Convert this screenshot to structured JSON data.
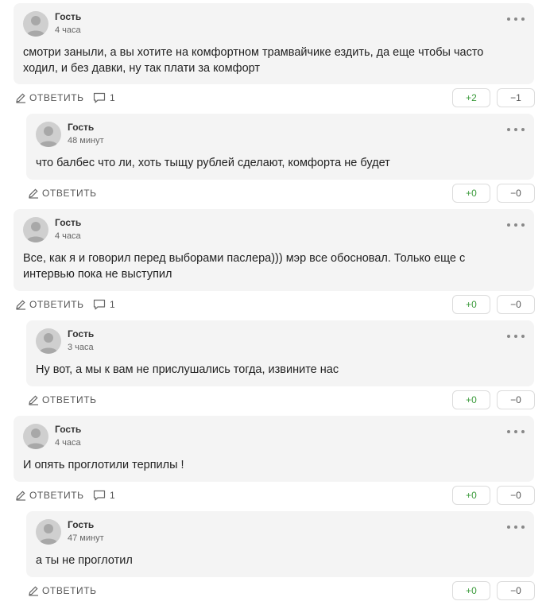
{
  "labels": {
    "reply": "ОТВЕТИТЬ"
  },
  "colors": {
    "bubble": "#f4f4f4",
    "plus": "#3a9a3a",
    "minus": "#555555"
  },
  "comments": [
    {
      "author": "Гость",
      "time": "4 часа",
      "lines": [
        "смотри заныли, а вы хотите на комфортном трамвайчике ездить, да еще чтобы часто",
        "ходил, и без давки, ну так плати за комфорт"
      ],
      "replies_count": "1",
      "plus": "+2",
      "minus": "−1"
    },
    {
      "author": "Гость",
      "time": "48 минут",
      "lines": [
        "что балбес что ли, хоть тыщу рублей сделают, комфорта не будет"
      ],
      "plus": "+0",
      "minus": "−0"
    },
    {
      "author": "Гость",
      "time": "4 часа",
      "lines": [
        "Все, как я и говорил перед выборами паслера))) мэр все обосновал. Только еще с",
        "интервью пока не выступил"
      ],
      "replies_count": "1",
      "plus": "+0",
      "minus": "−0"
    },
    {
      "author": "Гость",
      "time": "3 часа",
      "lines": [
        "Ну вот, а мы к вам не прислушались тогда, извините нас"
      ],
      "plus": "+0",
      "minus": "−0"
    },
    {
      "author": "Гость",
      "time": "4 часа",
      "lines": [
        "И опять проглотили терпилы !"
      ],
      "replies_count": "1",
      "plus": "+0",
      "minus": "−0"
    },
    {
      "author": "Гость",
      "time": "47 минут",
      "lines": [
        "а ты не проглотил"
      ],
      "plus": "+0",
      "minus": "−0"
    }
  ]
}
